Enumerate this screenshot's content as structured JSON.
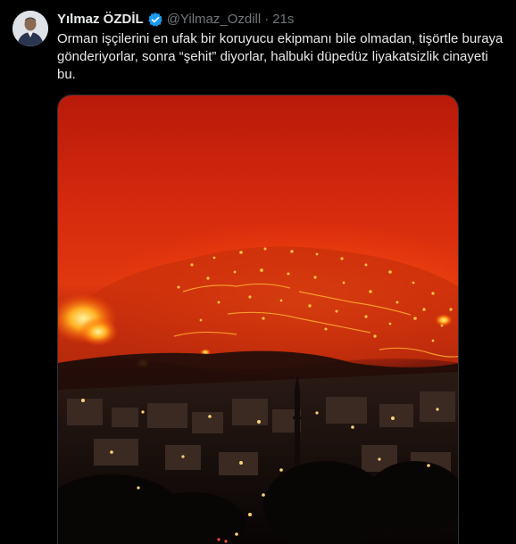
{
  "tweet": {
    "author_name": "Yılmaz ÖZDİL",
    "handle": "@Yilmaz_Ozdill",
    "separator": "·",
    "time": "21s",
    "text_lines": [
      "Orman işçilerini en ufak bir koruyucu ekipmanı bile olmadan, tişörtle buraya",
      "gönderiyorlar, sonra “şehit” diyorlar, halbuki düpedüz liyakatsizlik cinayeti",
      "bu."
    ],
    "verified_color": "#1d9bf0",
    "avatar_icon": "profile-photo",
    "media_icon": "wildfire-photo"
  }
}
